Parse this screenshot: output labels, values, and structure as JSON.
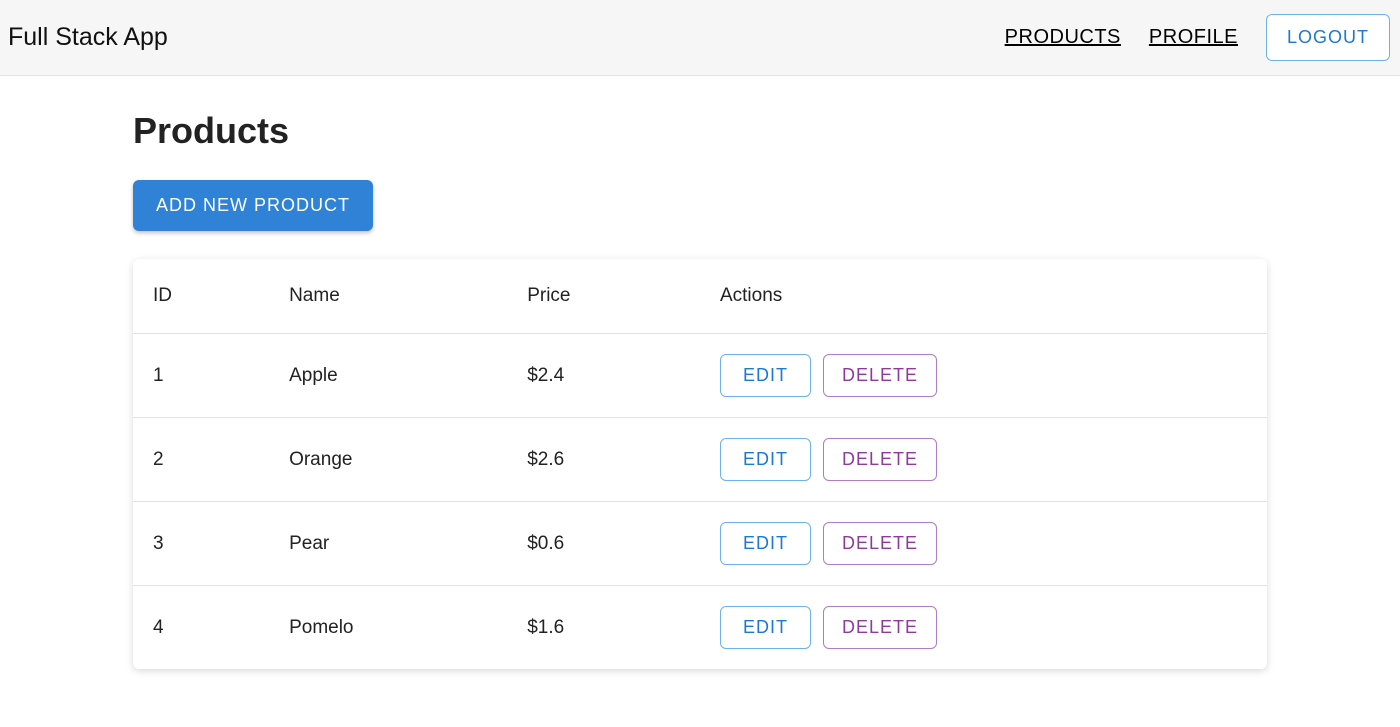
{
  "navbar": {
    "brand": "Full Stack App",
    "links": {
      "products": "PRODUCTS",
      "profile": "PROFILE"
    },
    "logout": "LOGOUT"
  },
  "page": {
    "title": "Products",
    "add_button": "ADD NEW PRODUCT"
  },
  "table": {
    "headers": {
      "id": "ID",
      "name": "Name",
      "price": "Price",
      "actions": "Actions"
    },
    "action_labels": {
      "edit": "EDIT",
      "delete": "DELETE"
    },
    "rows": [
      {
        "id": "1",
        "name": "Apple",
        "price": "$2.4"
      },
      {
        "id": "2",
        "name": "Orange",
        "price": "$2.6"
      },
      {
        "id": "3",
        "name": "Pear",
        "price": "$0.6"
      },
      {
        "id": "4",
        "name": "Pomelo",
        "price": "$1.6"
      }
    ]
  }
}
